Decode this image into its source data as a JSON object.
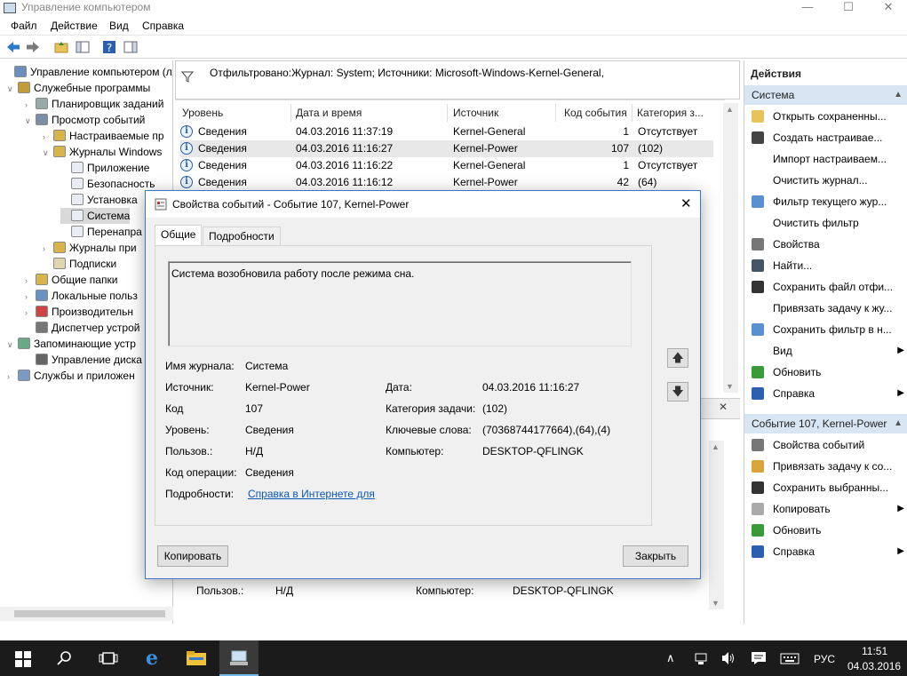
{
  "window": {
    "title": "Управление компьютером"
  },
  "menu": [
    "Файл",
    "Действие",
    "Вид",
    "Справка"
  ],
  "tree": [
    {
      "label": "Управление компьютером (л",
      "level": 0,
      "arrow": ""
    },
    {
      "label": "Служебные программы",
      "level": 1,
      "arrow": "open"
    },
    {
      "label": "Планировщик заданий",
      "level": 2,
      "arrow": "closed"
    },
    {
      "label": "Просмотр событий",
      "level": 2,
      "arrow": "open"
    },
    {
      "label": "Настраиваемые пр",
      "level": 3,
      "arrow": "closed"
    },
    {
      "label": "Журналы Windows",
      "level": 3,
      "arrow": "open"
    },
    {
      "label": "Приложение",
      "level": 4,
      "arrow": ""
    },
    {
      "label": "Безопасность",
      "level": 4,
      "arrow": ""
    },
    {
      "label": "Установка",
      "level": 4,
      "arrow": ""
    },
    {
      "label": "Система",
      "level": 4,
      "arrow": "",
      "selected": true
    },
    {
      "label": "Перенапра",
      "level": 4,
      "arrow": ""
    },
    {
      "label": "Журналы при",
      "level": 3,
      "arrow": "closed"
    },
    {
      "label": "Подписки",
      "level": 3,
      "arrow": ""
    },
    {
      "label": "Общие папки",
      "level": 2,
      "arrow": "closed"
    },
    {
      "label": "Локальные польз",
      "level": 2,
      "arrow": "closed"
    },
    {
      "label": "Производительн",
      "level": 2,
      "arrow": "closed"
    },
    {
      "label": "Диспетчер устрой",
      "level": 2,
      "arrow": ""
    },
    {
      "label": "Запоминающие устр",
      "level": 1,
      "arrow": "open"
    },
    {
      "label": "Управление диска",
      "level": 2,
      "arrow": ""
    },
    {
      "label": "Службы и приложен",
      "level": 1,
      "arrow": "closed"
    }
  ],
  "filter": {
    "text": "Отфильтровано:Журнал: System; Источники: Microsoft-Windows-Kernel-General,"
  },
  "columns": [
    "Уровень",
    "Дата и время",
    "Источник",
    "Код события",
    "Категория з..."
  ],
  "events": [
    {
      "level": "Сведения",
      "date": "04.03.2016 11:37:19",
      "source": "Kernel-General",
      "id": "1",
      "cat": "Отсутствует"
    },
    {
      "level": "Сведения",
      "date": "04.03.2016 11:16:27",
      "source": "Kernel-Power",
      "id": "107",
      "cat": "(102)"
    },
    {
      "level": "Сведения",
      "date": "04.03.2016 11:16:22",
      "source": "Kernel-General",
      "id": "1",
      "cat": "Отсутствует"
    },
    {
      "level": "Сведения",
      "date": "04.03.2016 11:16:12",
      "source": "Kernel-Power",
      "id": "42",
      "cat": "(64)"
    }
  ],
  "lower_preview": {
    "user_label": "Пользов.:",
    "user_value": "Н/Д",
    "computer_label": "Компьютер:",
    "computer_value": "DESKTOP-QFLINGK"
  },
  "actions": {
    "header": "Действия",
    "section1": "Система",
    "items1": [
      "Открыть сохраненны...",
      "Создать настраивае...",
      "Импорт настраиваем...",
      "Очистить журнал...",
      "Фильтр текущего жур...",
      "Очистить фильтр",
      "Свойства",
      "Найти...",
      "Сохранить файл отфи...",
      "Привязать задачу к жу...",
      "Сохранить фильтр в н...",
      "Вид",
      "Обновить",
      "Справка"
    ],
    "section2": "Событие 107, Kernel-Power",
    "items2": [
      "Свойства событий",
      "Привязать задачу к со...",
      "Сохранить выбранны...",
      "Копировать",
      "Обновить",
      "Справка"
    ]
  },
  "dialog": {
    "title": "Свойства событий - Событие 107, Kernel-Power",
    "tabs": [
      "Общие",
      "Подробности"
    ],
    "description": "Система возобновила работу после режима сна.",
    "journal_label": "Имя журнала:",
    "journal_value": "Система",
    "source_label": "Источник:",
    "source_value": "Kernel-Power",
    "date_label": "Дата:",
    "date_value": "04.03.2016 11:16:27",
    "code_label": "Код",
    "code_value": "107",
    "category_label": "Категория задачи:",
    "category_value": "(102)",
    "level_label": "Уровень:",
    "level_value": "Сведения",
    "keywords_label": "Ключевые слова:",
    "keywords_value": "(70368744177664),(64),(4)",
    "user_label": "Пользов.:",
    "user_value": "Н/Д",
    "computer_label": "Компьютер:",
    "computer_value": "DESKTOP-QFLINGK",
    "opcode_label": "Код операции:",
    "opcode_value": "Сведения",
    "details_label": "Подробности:",
    "details_link": "Справка в Интернете для",
    "copy_button": "Копировать",
    "close_button": "Закрыть"
  },
  "taskbar": {
    "lang": "РУС",
    "time": "11:51",
    "date": "04.03.2016"
  }
}
